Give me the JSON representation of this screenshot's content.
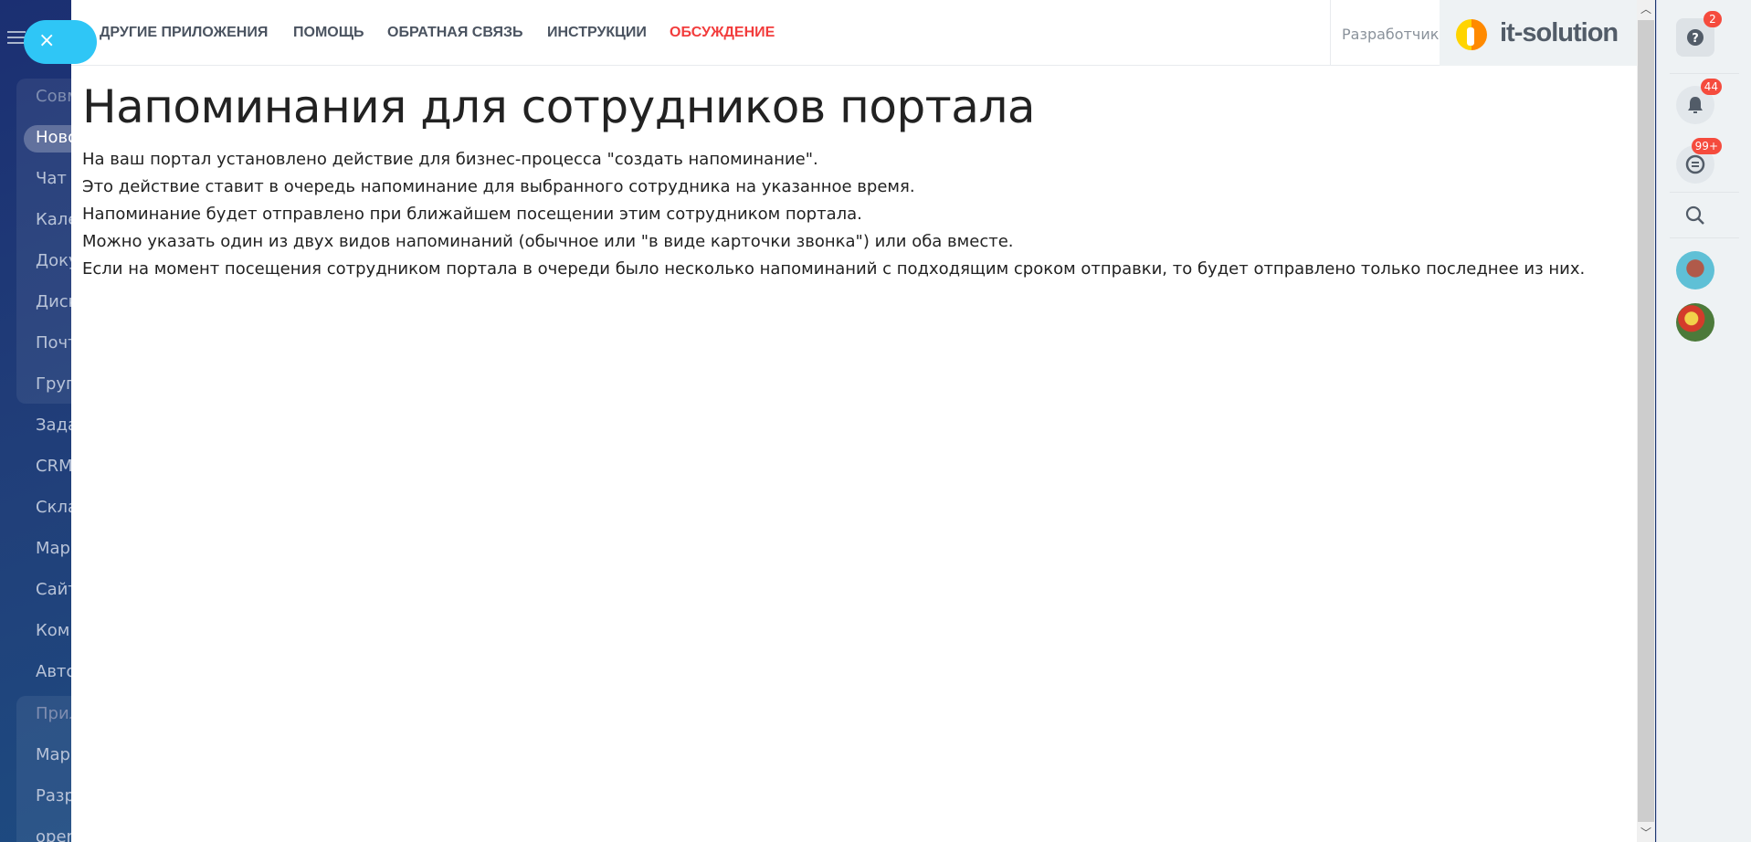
{
  "sidebar": {
    "close_icon": "×",
    "items": [
      "Совм",
      "Ново",
      "Чат и",
      "Кале",
      "Доку",
      "Диск",
      "Почт",
      "Груп",
      "Зада",
      "CRM",
      "Скла",
      "Мар",
      "Сайт",
      "Ком",
      "Авто",
      "Прил",
      "Мар",
      "Разр",
      "oper"
    ]
  },
  "topnav": {
    "links": [
      "ДРУГИЕ ПРИЛОЖЕНИЯ",
      "ПОМОЩЬ",
      "ОБРАТНАЯ СВЯЗЬ",
      "ИНСТРУКЦИИ",
      "ОБСУЖДЕНИЕ"
    ],
    "developer_label": "Разработчик",
    "logo_text": "it-solution"
  },
  "main": {
    "title": "Напоминания для сотрудников портала",
    "paragraphs": [
      "На ваш портал установлено действие для бизнес-процесса \"создать напоминание\".",
      "Это действие ставит в очередь напоминание для выбранного сотрудника на указанное время.",
      "Напоминание будет отправлено при ближайшем посещении этим сотрудником портала.",
      "Можно указать один из двух видов напоминаний (обычное или \"в виде карточки звонка\") или оба вместе.",
      "Если на момент посещения сотрудником портала в очереди было несколько напоминаний с подходящим сроком отправки, то будет отправлено только последнее из них."
    ]
  },
  "rightbar": {
    "help_badge": "2",
    "notifications_badge": "44",
    "chat_badge": "99+"
  },
  "colors": {
    "accent": "#2fc6f6",
    "red_link": "#f23c3c",
    "badge": "#f54b3d"
  }
}
